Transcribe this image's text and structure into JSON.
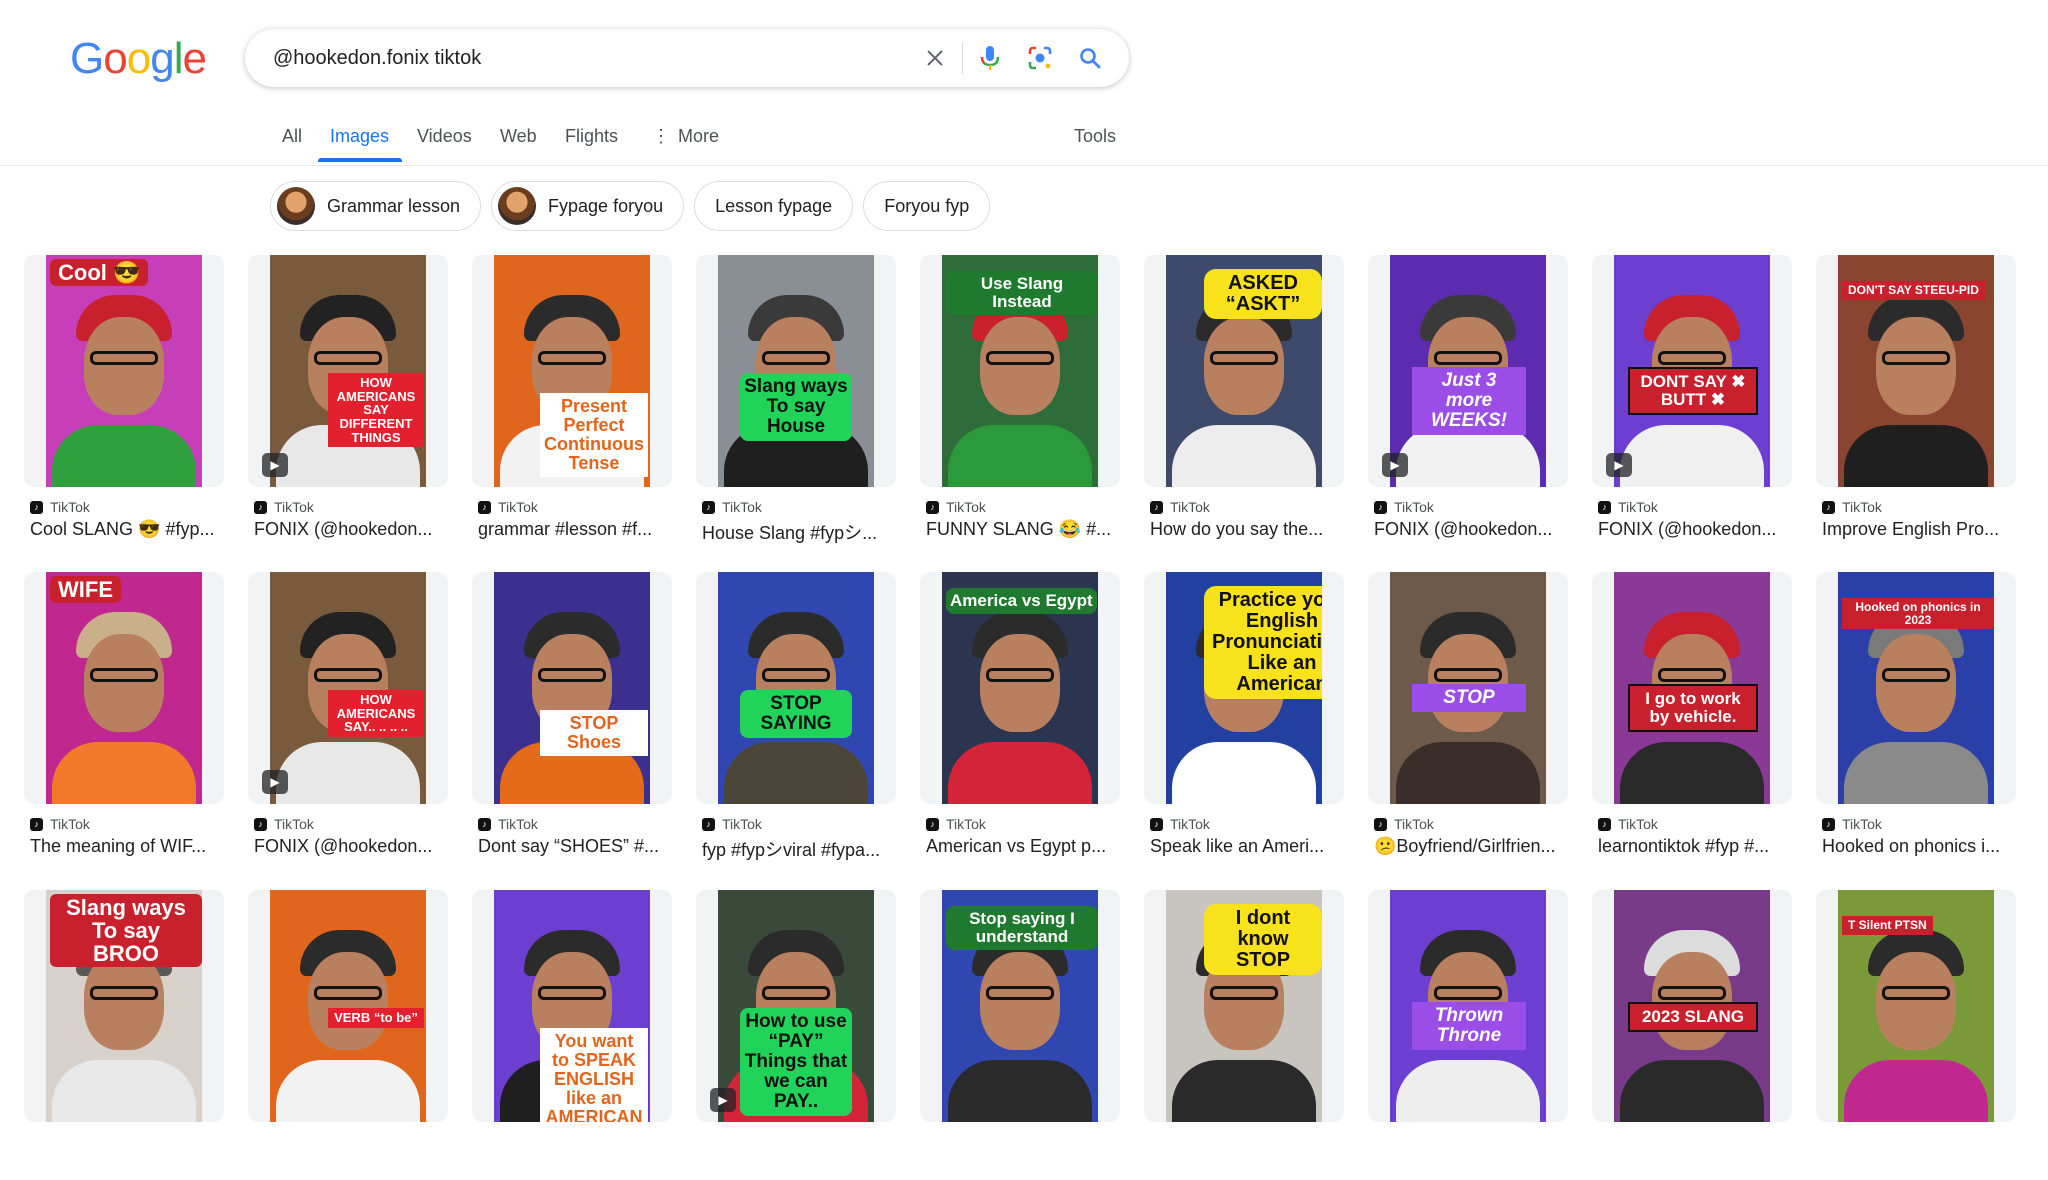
{
  "logo": {
    "letters": [
      "G",
      "o",
      "o",
      "g",
      "l",
      "e"
    ],
    "colors": [
      "#4285F4",
      "#EA4335",
      "#FBBC05",
      "#4285F4",
      "#34A853",
      "#EA4335"
    ]
  },
  "search": {
    "value": "@hookedon.fonix tiktok",
    "icons": [
      "close-icon",
      "microphone-icon",
      "lens-icon",
      "search-icon"
    ]
  },
  "tabs": {
    "items": [
      {
        "label": "All",
        "active": false
      },
      {
        "label": "Images",
        "active": true
      },
      {
        "label": "Videos",
        "active": false
      },
      {
        "label": "Web",
        "active": false
      },
      {
        "label": "Flights",
        "active": false
      },
      {
        "label": "More",
        "active": false
      }
    ],
    "tools": "Tools",
    "more_icon": "vertical-dots-icon"
  },
  "chips": [
    {
      "label": "Grammar lesson",
      "thumb": true
    },
    {
      "label": "Fypage foryou",
      "thumb": true
    },
    {
      "label": "Lesson fypage",
      "thumb": false
    },
    {
      "label": "Foryou fyp",
      "thumb": false
    }
  ],
  "results": [
    {
      "source": "TikTok",
      "title": "Cool SLANG 😎 #fyp...",
      "overlay": "Cool 😎",
      "bg": "#c73fb8",
      "shirt": "#2f9e3c",
      "cap": "#c8202c",
      "video": false
    },
    {
      "source": "TikTok",
      "title": "FONIX (@hookedon...",
      "overlay": "HOW AMERICANS SAY DIFFERENT THINGS",
      "bg": "#7a5a3c",
      "shirt": "#e8e8e8",
      "cap": "#222",
      "video": true
    },
    {
      "source": "TikTok",
      "title": "grammar #lesson #f...",
      "overlay": "Present Perfect Continuous Tense",
      "bg": "#e0661d",
      "shirt": "#f2f2f2",
      "cap": "#2b2b2b",
      "video": false
    },
    {
      "source": "TikTok",
      "title": "House Slang #fypシ...",
      "overlay": "Slang ways To say House",
      "bg": "#8a8f96",
      "shirt": "#1f1f1f",
      "cap": "#3a3a3a",
      "video": false
    },
    {
      "source": "TikTok",
      "title": "FUNNY SLANG 😂 #...",
      "overlay": "Use Slang Instead",
      "bg": "#2e6d3a",
      "shirt": "#2a9a3a",
      "cap": "#c8202c",
      "video": false
    },
    {
      "source": "TikTok",
      "title": "How do you say the...",
      "overlay": "ASKED “ASKT”",
      "bg": "#3d4a6b",
      "shirt": "#ededed",
      "cap": "#2b2b2b",
      "video": false
    },
    {
      "source": "TikTok",
      "title": "FONIX (@hookedon...",
      "overlay": "Just 3 more WEEKS!",
      "bg": "#5c2bb0",
      "shirt": "#f2f2f2",
      "cap": "#3a3a3a",
      "video": true
    },
    {
      "source": "TikTok",
      "title": "FONIX (@hookedon...",
      "overlay": "DONT SAY ✖ BUTT ✖",
      "bg": "#6d3fd1",
      "shirt": "#f0f0f0",
      "cap": "#c8202c",
      "video": true
    },
    {
      "source": "TikTok",
      "title": "Improve English Pro...",
      "overlay": "DON'T SAY STEEU-PID",
      "bg": "#8a4530",
      "shirt": "#1f1f1f",
      "cap": "#2b2b2b",
      "video": false
    },
    {
      "source": "TikTok",
      "title": "The meaning of WIF...",
      "overlay": "WIFE",
      "bg": "#c0288f",
      "shirt": "#f07a2a",
      "cap": "#c9b08a",
      "video": false
    },
    {
      "source": "TikTok",
      "title": "FONIX (@hookedon...",
      "overlay": "HOW AMERICANS SAY.. .. .. ..",
      "bg": "#7a5a3c",
      "shirt": "#e8e8e8",
      "cap": "#222",
      "video": true
    },
    {
      "source": "TikTok",
      "title": "Dont say “SHOES” #...",
      "overlay": "STOP Shoes",
      "bg": "#3b2f8f",
      "shirt": "#e36b1a",
      "cap": "#2b2b2b",
      "video": false
    },
    {
      "source": "TikTok",
      "title": "fyp #fypシviral #fypa...",
      "overlay": "STOP SAYING",
      "bg": "#3046b0",
      "shirt": "#4a4536",
      "cap": "#2b2b2b",
      "video": false
    },
    {
      "source": "TikTok",
      "title": "American vs Egypt p...",
      "overlay": "America vs Egypt",
      "bg": "#2b3550",
      "shirt": "#d4243a",
      "cap": "#2b2b2b",
      "video": false
    },
    {
      "source": "TikTok",
      "title": "Speak like an Ameri...",
      "overlay": "Practice your English Pronunciation. Like an American",
      "bg": "#2140a0",
      "shirt": "#ffffff",
      "cap": "#2b2b2b",
      "video": false
    },
    {
      "source": "TikTok",
      "title": "😕Boyfriend/Girlfrien...",
      "overlay": "STOP",
      "bg": "#6d5a4b",
      "shirt": "#3a2e2a",
      "cap": "#2b2b2b",
      "video": false
    },
    {
      "source": "TikTok",
      "title": "learnontiktok #fyp #...",
      "overlay": "I go to work by vehicle.",
      "bg": "#8a3a96",
      "shirt": "#2a2a2a",
      "cap": "#c8202c",
      "video": false
    },
    {
      "source": "TikTok",
      "title": "Hooked on phonics i...",
      "overlay": "Hooked on phonics in 2023",
      "bg": "#2a3fa8",
      "shirt": "#8a8a8a",
      "cap": "#7a7a7a",
      "video": false
    },
    {
      "source": "",
      "title": "",
      "overlay": "Slang ways To say BROO",
      "bg": "#d9d2cc",
      "shirt": "#e8e8e8",
      "cap": "#5a5a5a",
      "video": false
    },
    {
      "source": "",
      "title": "",
      "overlay": "VERB “to be”",
      "bg": "#e0661d",
      "shirt": "#f2f2f2",
      "cap": "#2b2b2b",
      "video": false
    },
    {
      "source": "",
      "title": "",
      "overlay": "You want to SPEAK ENGLISH like an AMERICAN",
      "bg": "#6d3fd1",
      "shirt": "#1f1f1f",
      "cap": "#2b2b2b",
      "video": false
    },
    {
      "source": "",
      "title": "",
      "overlay": "How to use “PAY” Things that we can PAY..",
      "bg": "#3a4a3a",
      "shirt": "#d4243a",
      "cap": "#2b2b2b",
      "video": true
    },
    {
      "source": "",
      "title": "",
      "overlay": "Stop saying I understand",
      "bg": "#3046b0",
      "shirt": "#2a2a2a",
      "cap": "#2b2b2b",
      "video": false
    },
    {
      "source": "",
      "title": "",
      "overlay": "I dont know STOP",
      "bg": "#c8c5c0",
      "shirt": "#2a2a2a",
      "cap": "#2b2b2b",
      "video": false
    },
    {
      "source": "",
      "title": "",
      "overlay": "Thrown Throne",
      "bg": "#6d3fd1",
      "shirt": "#eeeeee",
      "cap": "#2b2b2b",
      "video": false
    },
    {
      "source": "",
      "title": "",
      "overlay": "2023 SLANG",
      "bg": "#7a3a8a",
      "shirt": "#2a2a2a",
      "cap": "#dcdcdc",
      "video": false
    },
    {
      "source": "",
      "title": "",
      "overlay": "T Silent PTSN",
      "bg": "#7a9a3a",
      "shirt": "#c0288f",
      "cap": "#2b2b2b",
      "video": false
    }
  ]
}
